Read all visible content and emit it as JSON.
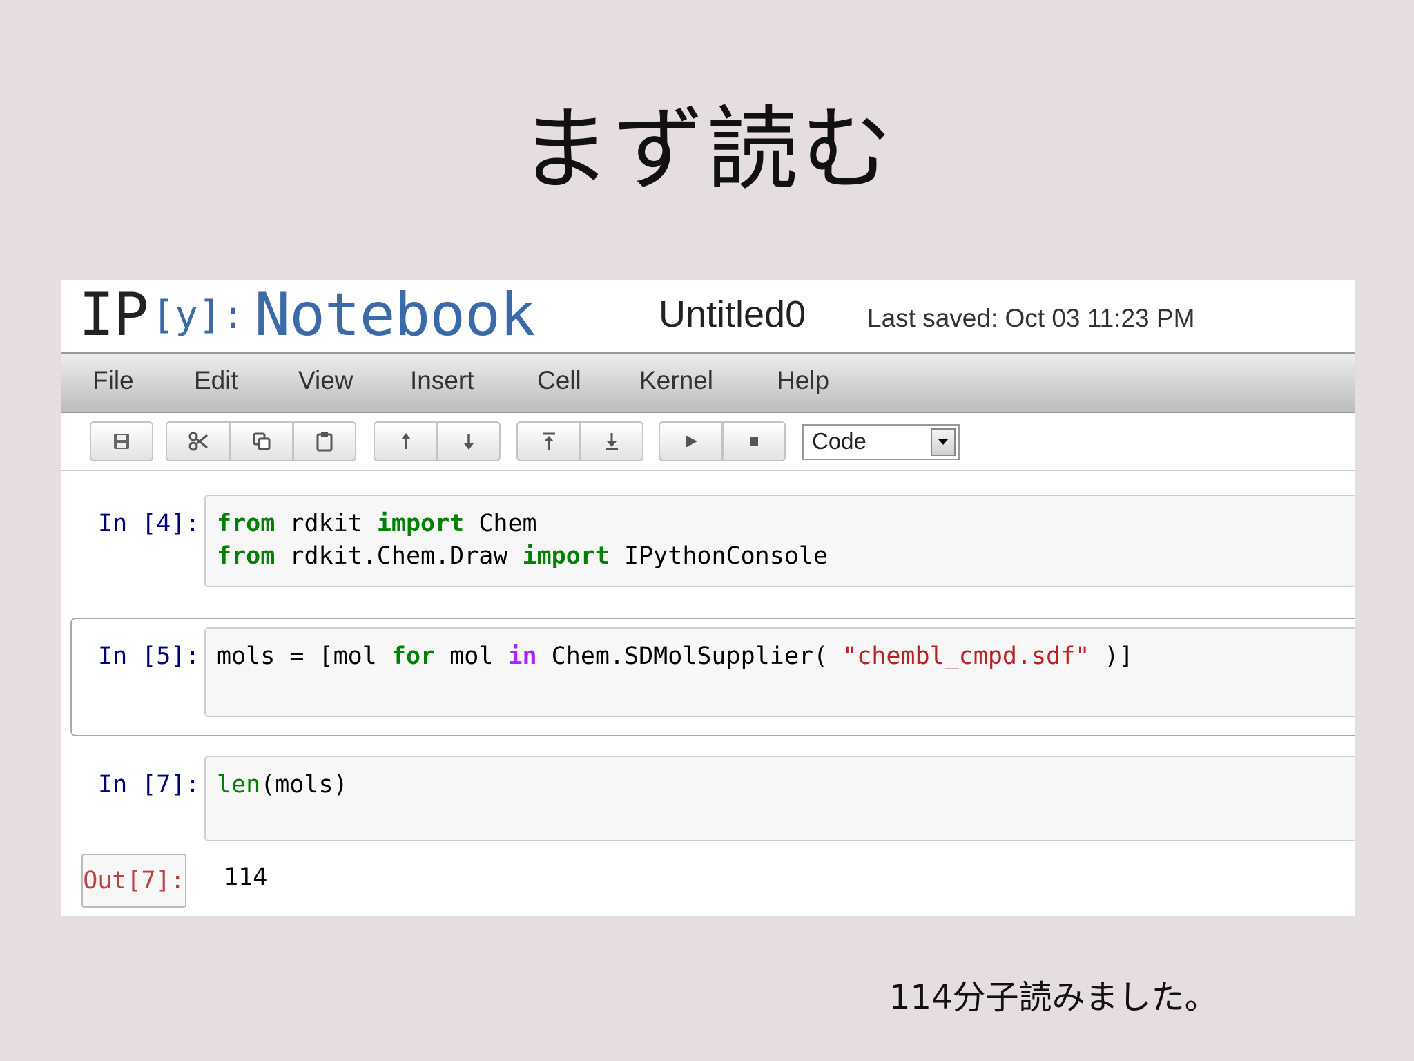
{
  "slide": {
    "title": "まず読む",
    "caption": "114分子読みました。"
  },
  "header": {
    "logo_ip": "IP",
    "logo_y": "[y]:",
    "logo_notebook": "Notebook",
    "notebook_name": "Untitled0",
    "last_saved": "Last saved: Oct 03 11:23 PM"
  },
  "menu": [
    "File",
    "Edit",
    "View",
    "Insert",
    "Cell",
    "Kernel",
    "Help"
  ],
  "toolbar": {
    "icons": [
      "save-icon",
      "cut-icon",
      "copy-icon",
      "paste-icon",
      "move-up-icon",
      "move-down-icon",
      "insert-above-icon",
      "insert-below-icon",
      "run-icon",
      "stop-icon"
    ],
    "cell_type": "Code"
  },
  "cells": [
    {
      "prompt": "In [4]:",
      "lines": [
        {
          "kw1": "from",
          "t1": " rdkit ",
          "kw2": "import",
          "t2": " Chem"
        },
        {
          "kw1": "from",
          "t1": " rdkit.Chem.Draw ",
          "kw2": "import",
          "t2": " IPythonConsole"
        }
      ]
    },
    {
      "prompt": "In [5]:",
      "code": {
        "a": "mols = [mol ",
        "kw_for": "for",
        "b": " mol ",
        "kw_in": "in",
        "c": " Chem.SDMolSupplier( ",
        "str": "\"chembl_cmpd.sdf\"",
        "d": " )]"
      }
    },
    {
      "prompt": "In [7]:",
      "code": {
        "fn": "len",
        "rest": "(mols)"
      },
      "out_prompt": "Out[7]:",
      "output": "114"
    }
  ]
}
